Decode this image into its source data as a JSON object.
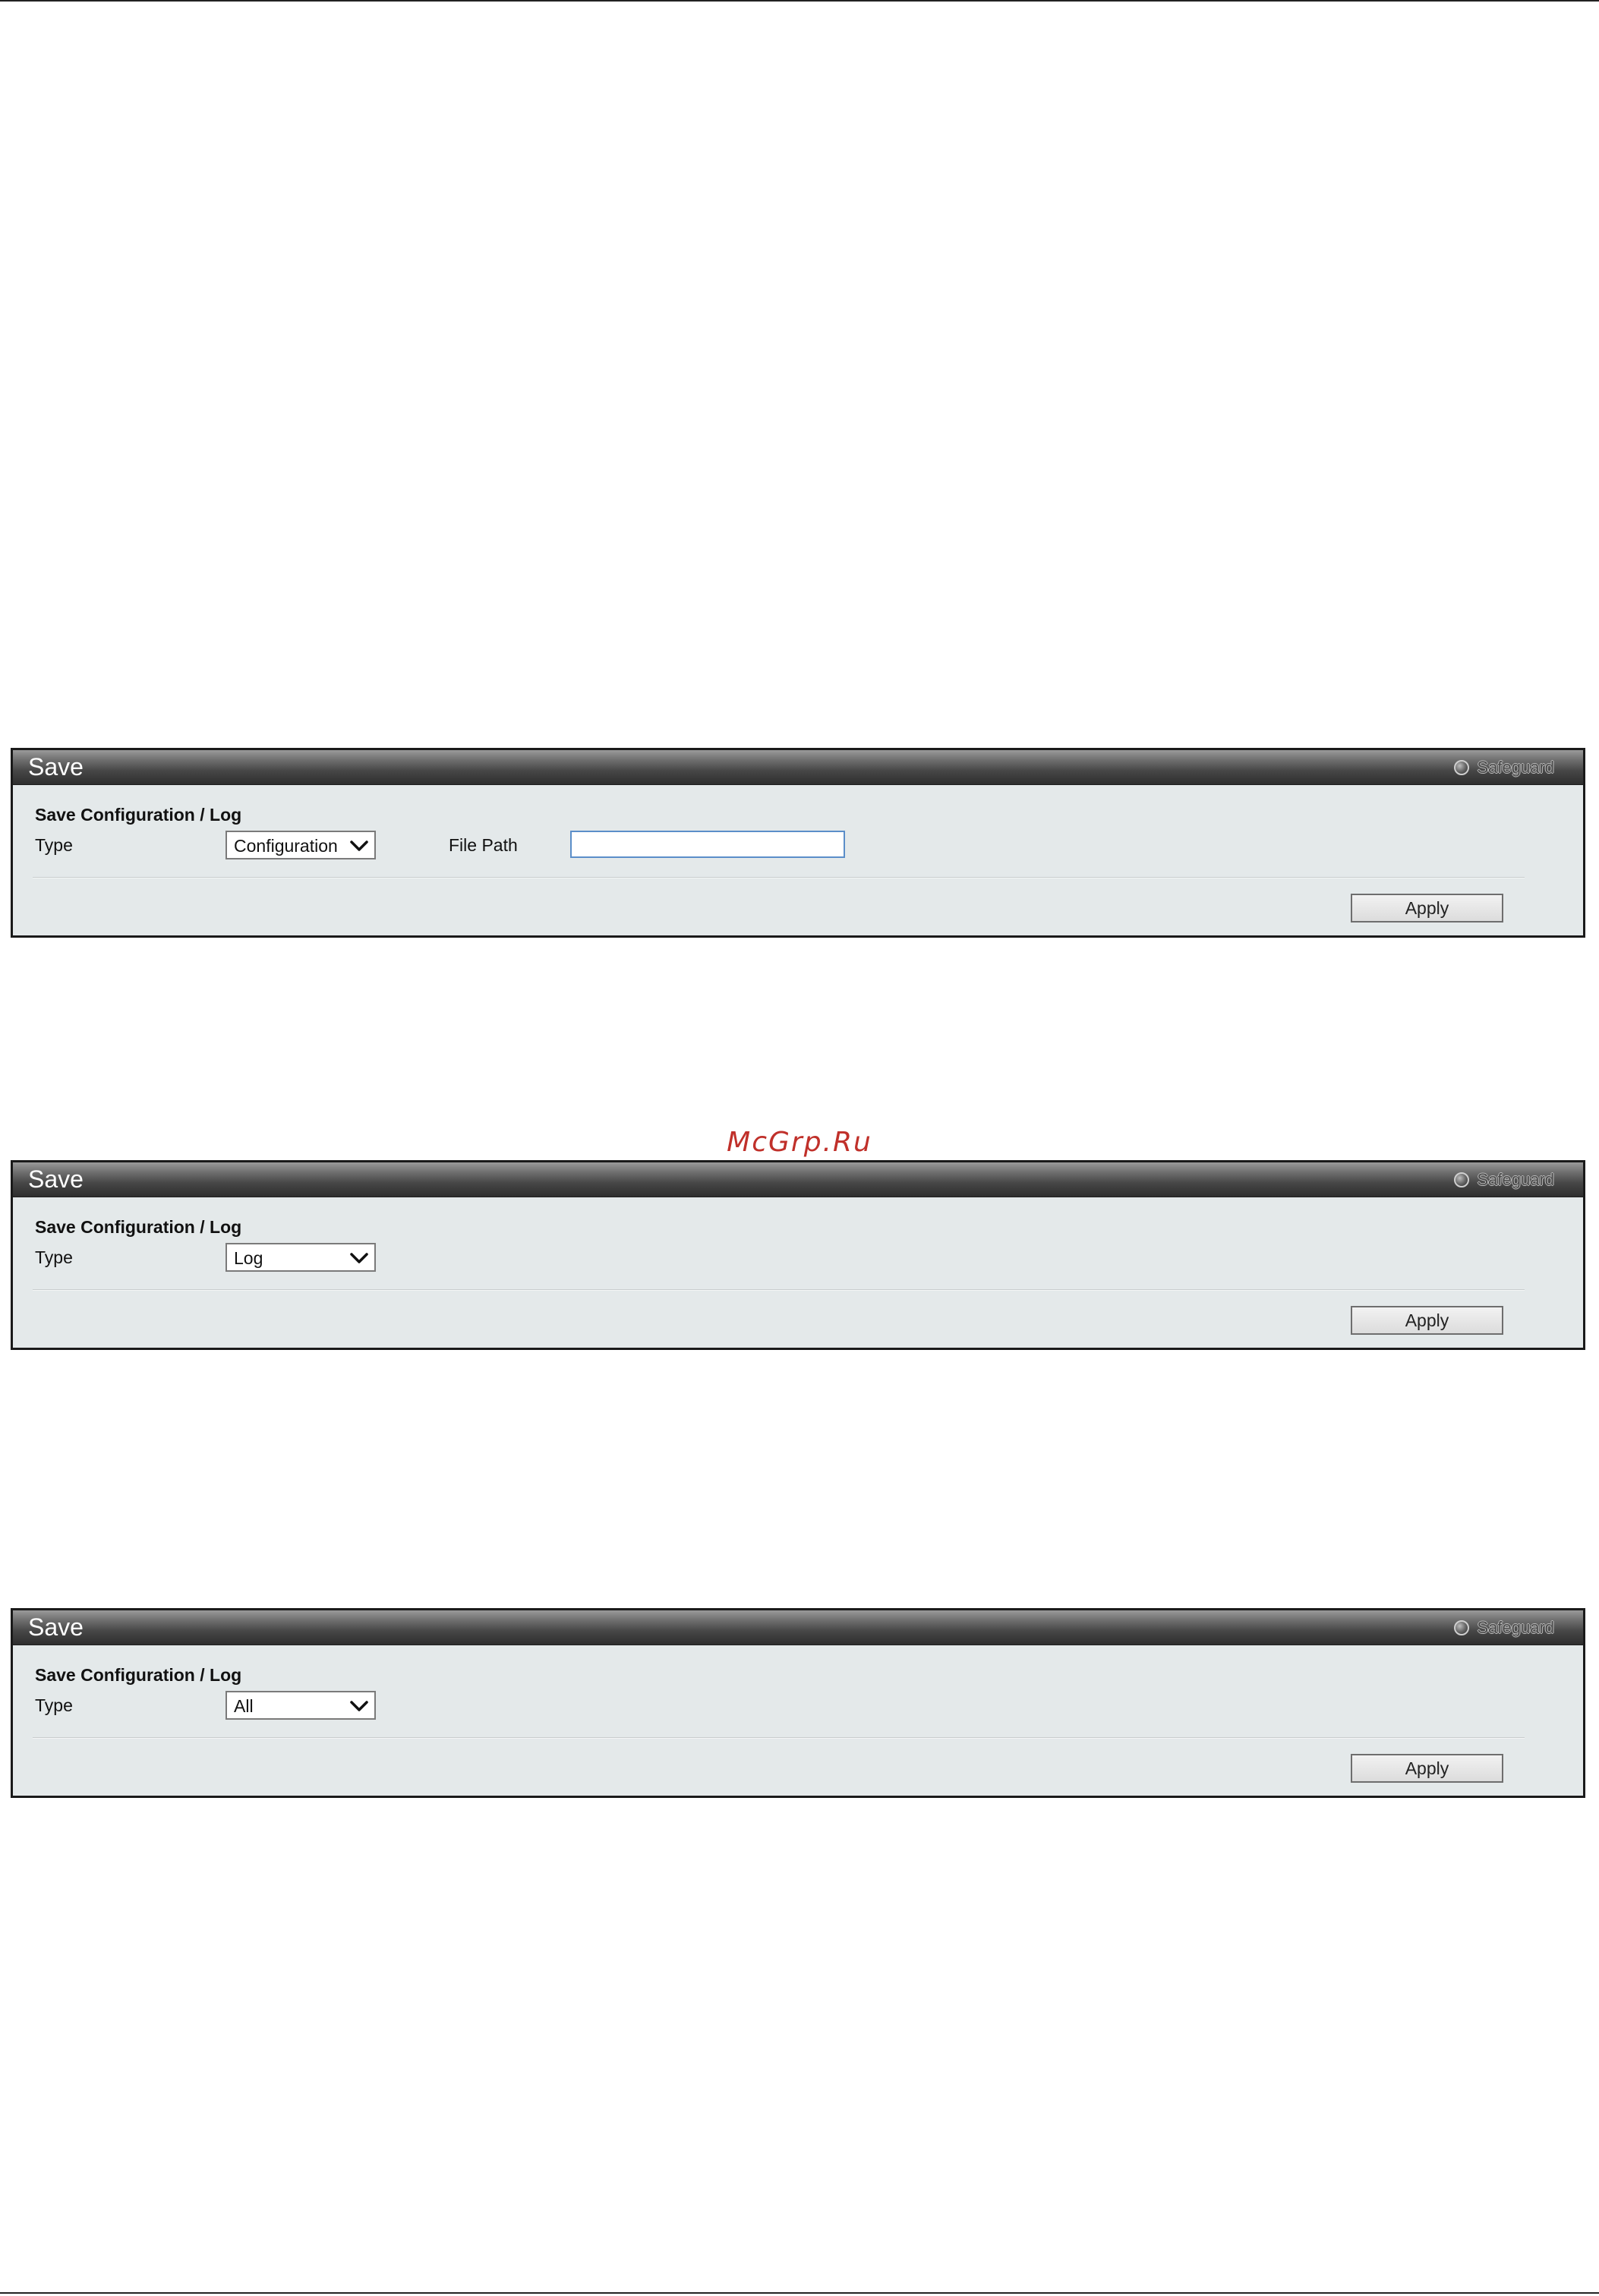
{
  "watermark": "McGrp.Ru",
  "panels": [
    {
      "title": "Save",
      "safeguard_label": "Safeguard",
      "section_title": "Save Configuration / Log",
      "type_label": "Type",
      "type_value": "Configuration",
      "file_path_label": "File Path",
      "file_path_value": "",
      "apply_label": "Apply"
    },
    {
      "title": "Save",
      "safeguard_label": "Safeguard",
      "section_title": "Save Configuration / Log",
      "type_label": "Type",
      "type_value": "Log",
      "apply_label": "Apply"
    },
    {
      "title": "Save",
      "safeguard_label": "Safeguard",
      "section_title": "Save Configuration / Log",
      "type_label": "Type",
      "type_value": "All",
      "apply_label": "Apply"
    }
  ],
  "icons": {
    "safeguard": "safeguard-indicator-icon",
    "dropdown": "chevron-down-icon"
  },
  "colors": {
    "header_dark": "#2e2e2e",
    "panel_background": "#e4e9ea",
    "watermark": "#c0302a",
    "input_focus_border": "#5b8ec9"
  }
}
